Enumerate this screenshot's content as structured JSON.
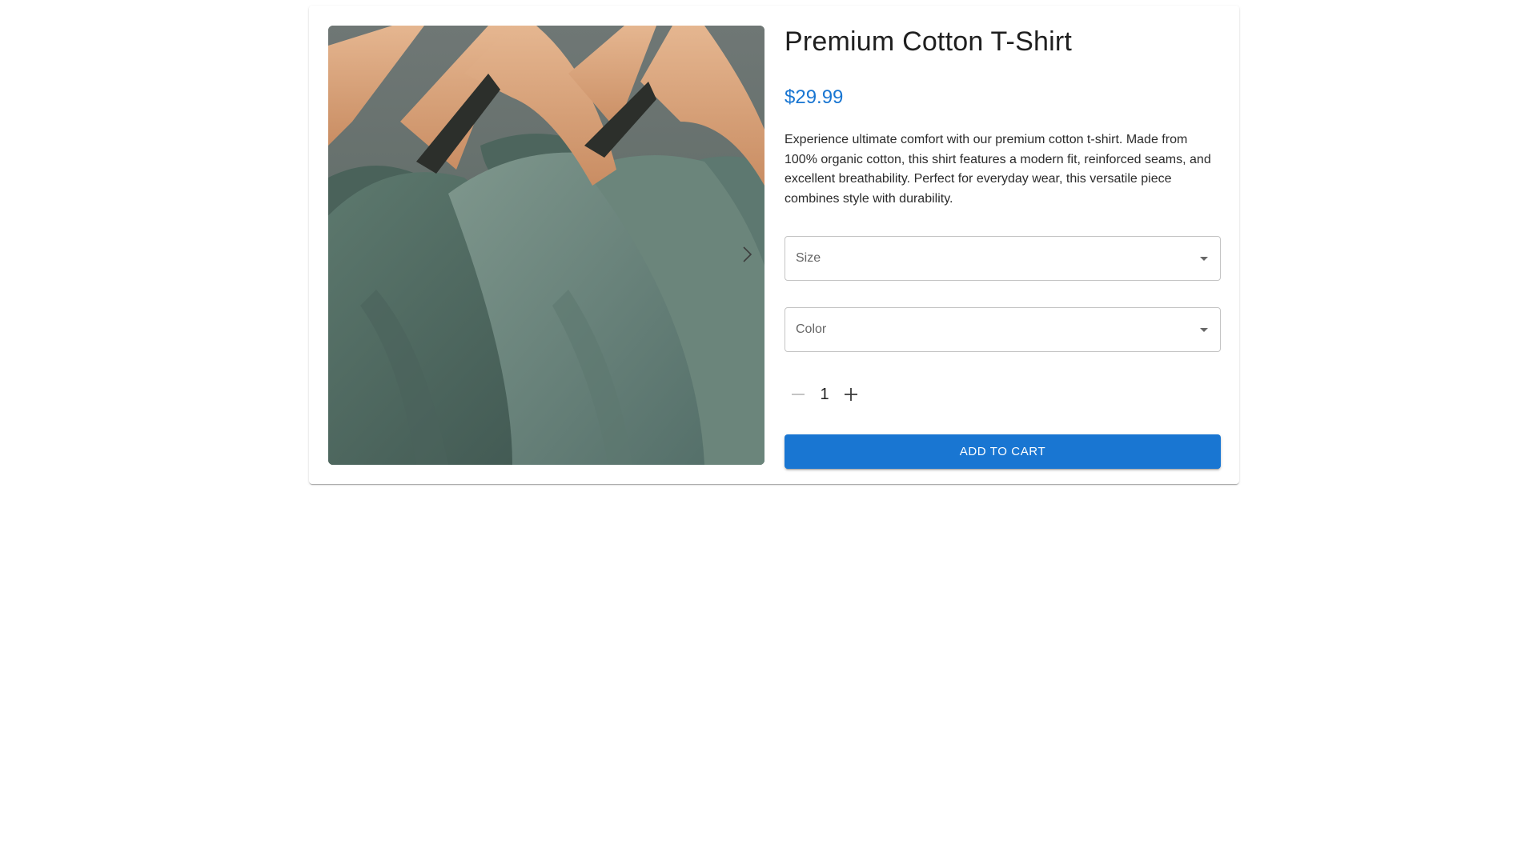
{
  "product": {
    "title": "Premium Cotton T-Shirt",
    "price": "$29.99",
    "description": "Experience ultimate comfort with our premium cotton t-shirt. Made from 100% organic cotton, this shirt features a modern fit, reinforced seams, and excellent breathability. Perfect for everyday wear, this versatile piece combines style with durability.",
    "image_icon": "product-photo-tshirts-on-hangers"
  },
  "options": {
    "size_label": "Size",
    "color_label": "Color"
  },
  "quantity": {
    "value": "1",
    "decrement_icon": "minus-icon",
    "increment_icon": "plus-icon"
  },
  "actions": {
    "add_to_cart_label": "Add to cart"
  },
  "colors": {
    "accent": "#1976d2",
    "shirt": "#6a8278",
    "hanger": "#d7a07a",
    "backdrop": "#7d8585"
  }
}
